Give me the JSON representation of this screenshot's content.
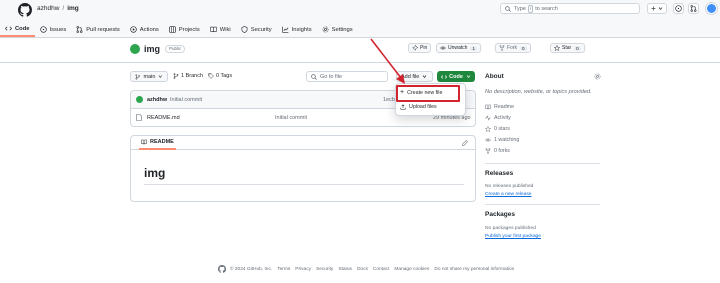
{
  "header": {
    "owner": "azhdhw",
    "repo": "img",
    "search_placeholder_pre": "Type",
    "search_key": "/",
    "search_placeholder_post": "to search",
    "plus_label": "+"
  },
  "tabs": [
    {
      "label": "Code"
    },
    {
      "label": "Issues"
    },
    {
      "label": "Pull requests"
    },
    {
      "label": "Actions"
    },
    {
      "label": "Projects"
    },
    {
      "label": "Wiki"
    },
    {
      "label": "Security"
    },
    {
      "label": "Insights"
    },
    {
      "label": "Settings"
    }
  ],
  "repo": {
    "name": "img",
    "visibility": "Public",
    "pin_label": "Pin",
    "unwatch_label": "Unwatch",
    "unwatch_count": "1",
    "fork_label": "Fork",
    "fork_count": "0",
    "star_label": "Star",
    "star_count": "0"
  },
  "controls": {
    "branch": "main",
    "branches": "1 Branch",
    "tags": "0 Tags",
    "goto_placeholder": "Go to file",
    "add_file": "Add file",
    "code": "Code"
  },
  "dropdown": {
    "create_new_file": "Create new file",
    "upload_files": "Upload files"
  },
  "files": {
    "commit_author": "azhdhw",
    "commit_message": "Initial commit",
    "commit_hash_partial": "1ecb",
    "rows": [
      {
        "name": "README.md",
        "message": "Initial commit",
        "time": "29 minutes ago"
      }
    ]
  },
  "readme": {
    "tab_label": "README",
    "heading": "img"
  },
  "sidebar": {
    "about_title": "About",
    "description": "No description, website, or topics provided.",
    "readme": "Readme",
    "activity": "Activity",
    "stars": "0 stars",
    "watching": "1 watching",
    "forks": "0 forks",
    "releases_title": "Releases",
    "no_releases": "No releases published",
    "create_release": "Create a new release",
    "packages_title": "Packages",
    "no_packages": "No packages published",
    "publish_package": "Publish your first package"
  },
  "footer": {
    "copyright": "© 2024 GitHub, Inc.",
    "links": [
      "Terms",
      "Privacy",
      "Security",
      "Status",
      "Docs",
      "Contact",
      "Manage cookies",
      "Do not share my personal information"
    ]
  },
  "colors": {
    "accent_green": "#1f883d",
    "tab_underline": "#fd8c73",
    "highlight_red": "#d1242f",
    "arrow_red": "#d1242f",
    "link_blue": "#0969da"
  }
}
